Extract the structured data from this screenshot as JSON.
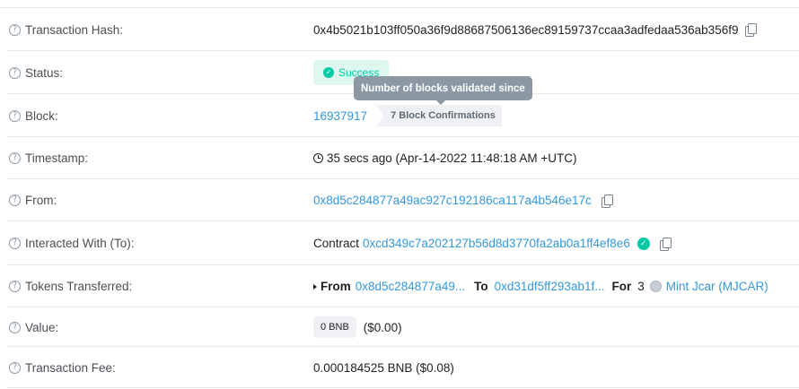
{
  "rows": {
    "tx_hash": {
      "label": "Transaction Hash:",
      "value": "0x4b5021b103ff050a36f9d88687506136ec89159737ccaa3adfedaa536ab356f9"
    },
    "status": {
      "label": "Status:",
      "value": "Success"
    },
    "block": {
      "label": "Block:",
      "number": "16937917",
      "confirmations": "7 Block Confirmations",
      "tooltip": "Number of blocks validated since"
    },
    "timestamp": {
      "label": "Timestamp:",
      "value": "35 secs ago (Apr-14-2022 11:48:18 AM +UTC)"
    },
    "from": {
      "label": "From:",
      "value": "0x8d5c284877a49ac927c192186ca117a4b546e17c"
    },
    "interacted_with": {
      "label": "Interacted With (To):",
      "prefix": "Contract",
      "address": "0xcd349c7a202127b56d8d3770fa2ab0a1ff4ef8e6"
    },
    "tokens_transferred": {
      "label": "Tokens Transferred:",
      "from_label": "From",
      "from_address": "0x8d5c284877a49...",
      "to_label": "To",
      "to_address": "0xd31df5ff293ab1f...",
      "for_label": "For",
      "amount": "3",
      "token_name": "Mint Jcar (MJCAR)"
    },
    "value": {
      "label": "Value:",
      "amount": "0 BNB",
      "usd": "($0.00)"
    },
    "tx_fee": {
      "label": "Transaction Fee:",
      "value": "0.000184525 BNB ($0.08)"
    }
  },
  "colors": {
    "link": "#3498db",
    "success": "#00c9a7",
    "success_bg": "#def7ef",
    "tooltip_bg": "#8c98a4",
    "divider": "#e7eaf3"
  },
  "icons": {
    "help": "question-circle-icon",
    "copy": "copy-icon",
    "success": "check-circle-icon",
    "clock": "clock-icon",
    "verified": "verified-check-icon",
    "expand": "caret-right-icon",
    "token": "token-logo-icon"
  }
}
